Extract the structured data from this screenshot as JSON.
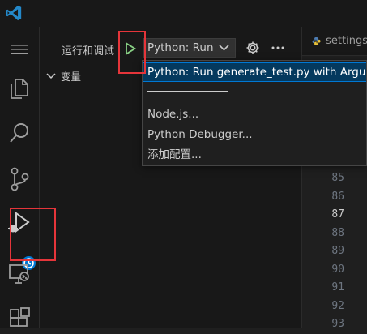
{
  "run_panel": {
    "title": "运行和调试",
    "config_selected": "Python: Run",
    "variables_label": "变量"
  },
  "editor": {
    "tab_label": "settings",
    "line_numbers": [
      "85",
      "86",
      "87",
      "88",
      "89",
      "90",
      "91",
      "92",
      "93"
    ],
    "active_line": "87"
  },
  "config_menu": {
    "items": [
      "Python: Run generate_test.py with Arguments",
      "Node.js...",
      "Python Debugger...",
      "添加配置..."
    ]
  },
  "colors": {
    "accent": "#0078d4",
    "highlight_box": "#e5353a",
    "play_green": "#89d185"
  },
  "icons": {
    "activity": [
      "explorer-icon",
      "search-icon",
      "source-control-icon",
      "run-debug-icon",
      "remote-explorer-icon",
      "extensions-icon"
    ]
  }
}
